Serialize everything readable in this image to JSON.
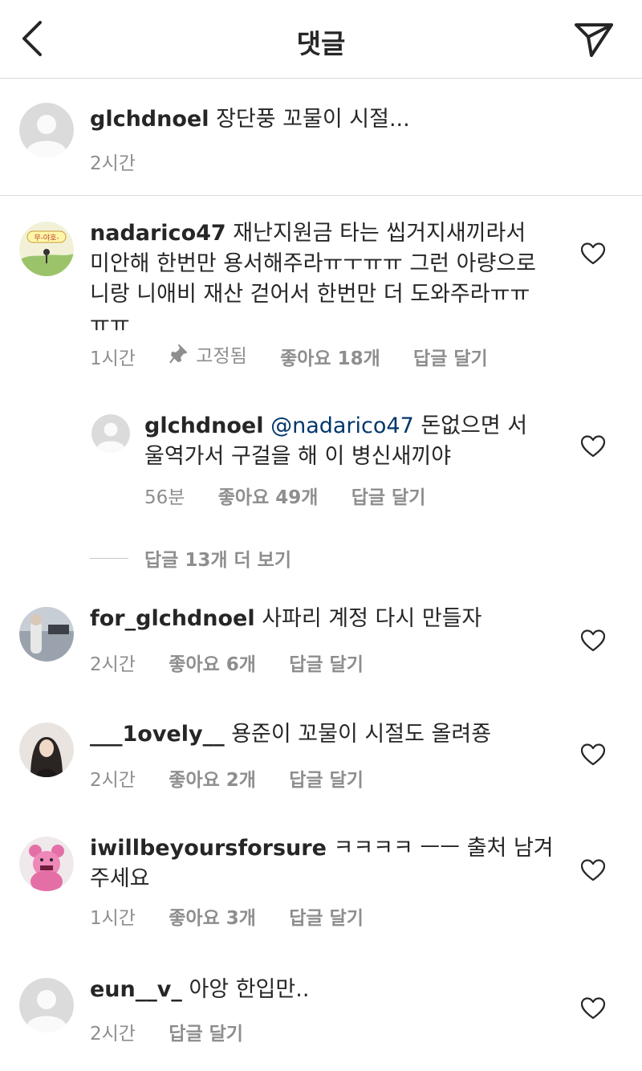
{
  "header": {
    "title": "댓글"
  },
  "caption": {
    "username": "glchdnoel",
    "text": "장단풍 꼬물이 시절...",
    "time": "2시간"
  },
  "comments": [
    {
      "username": "nadarico47",
      "text": "재난지원금 타는 씹거지새끼라서 미안해  한번만 용서해주라ㅠㅜㅠㅠ 그런 아량으로 니랑  니애비 재산 걷어서 한번만 더 도와주라ㅠㅠㅠㅠ",
      "time": "1시간",
      "pinned": "고정됨",
      "likes": "좋아요 18개",
      "reply": "답글 달기",
      "avatar_text": "무-야호-"
    },
    {
      "username": "glchdnoel",
      "mention": "@nadarico47",
      "text": " 돈없으면 서울역가서 구걸을 해 이 병신새끼야",
      "time": "56분",
      "likes": "좋아요 49개",
      "reply": "답글 달기"
    },
    {
      "more_replies": "답글 13개 더 보기"
    },
    {
      "username": "for_glchdnoel",
      "text": "사파리 계정 다시 만들자",
      "time": "2시간",
      "likes": "좋아요 6개",
      "reply": "답글 달기"
    },
    {
      "username": "___1ovely__",
      "text": "용준이 꼬물이 시절도 올려죵",
      "time": "2시간",
      "likes": "좋아요 2개",
      "reply": "답글 달기"
    },
    {
      "username": "iwillbeyoursforsure",
      "text": "ㅋㅋㅋㅋ ㅡㅡ 출처 남겨주세요",
      "time": "1시간",
      "likes": "좋아요 3개",
      "reply": "답글 달기"
    },
    {
      "username": "eun__v_",
      "text": "아앙 한입만..",
      "time": "2시간",
      "reply": "답글 달기"
    }
  ],
  "colors": {
    "text": "#262626",
    "secondary": "#8e8e8e",
    "link": "#00376b",
    "divider": "#dbdbdb"
  }
}
